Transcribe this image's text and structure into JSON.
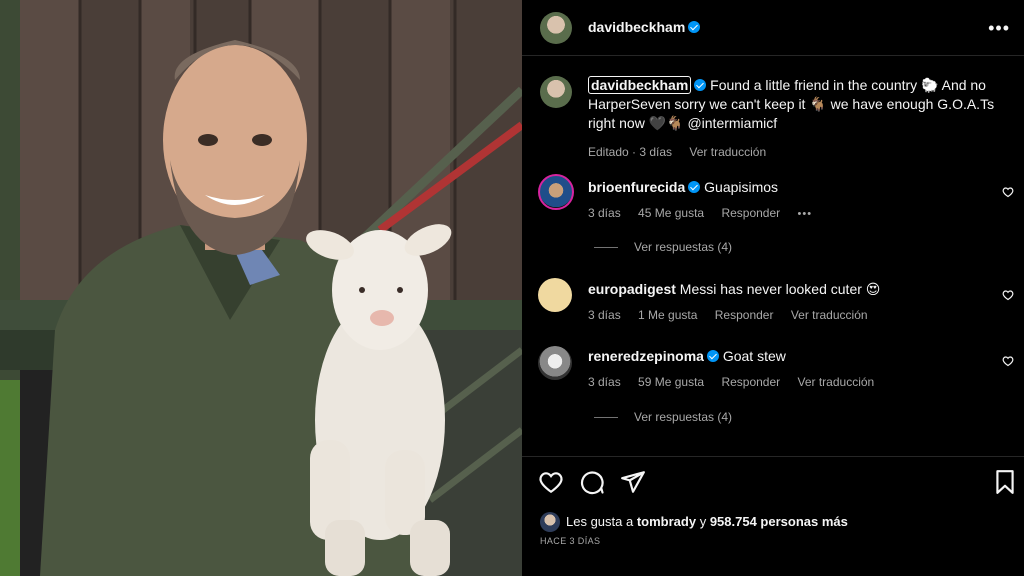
{
  "post": {
    "author": "davidbeckham",
    "caption": {
      "author": "davidbeckham",
      "text": "Found a little friend in the country 🐑 And no HarperSeven sorry we can't keep it 🐐 we have enough G.O.A.Ts right now 🖤🐐 @intermiamicf",
      "edited": "Editado · 3 días",
      "translate": "Ver traducción"
    }
  },
  "comments": [
    {
      "user": "brioenfurecida",
      "verified": true,
      "text": "Guapisimos",
      "time": "3 días",
      "likes": "45 Me gusta",
      "reply": "Responder",
      "more": "•••",
      "view_replies": "Ver respuestas (4)"
    },
    {
      "user": "europadigest",
      "verified": false,
      "text": "Messi has never looked cuter 😍",
      "time": "3 días",
      "likes": "1 Me gusta",
      "reply": "Responder",
      "translate": "Ver traducción"
    },
    {
      "user": "reneredzepinoma",
      "verified": true,
      "text": "Goat stew",
      "time": "3 días",
      "likes": "59 Me gusta",
      "reply": "Responder",
      "translate": "Ver traducción",
      "view_replies": "Ver respuestas (4)"
    }
  ],
  "likes": {
    "prefix": "Les gusta a",
    "user": "tombrady",
    "joiner": "y",
    "count": "958.754 personas más"
  },
  "posted_ago": "HACE 3 DÍAS",
  "icons": {
    "more": "more-options-icon",
    "like": "heart-icon",
    "comment": "comment-icon",
    "share": "share-icon",
    "save": "bookmark-icon"
  },
  "colors": {
    "background": "#000000",
    "verified": "#0095f6",
    "secondary_text": "#a8a8a8"
  }
}
